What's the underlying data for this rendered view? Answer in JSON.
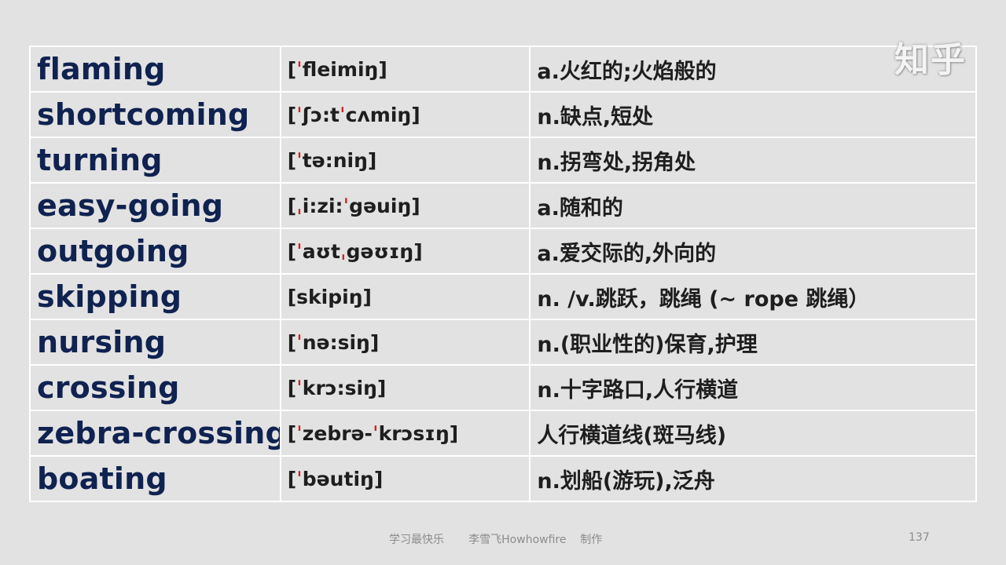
{
  "watermark": "知乎",
  "rows": [
    {
      "word": "flaming",
      "phonetic": "[ˈfleimiŋ]",
      "meaning": "a.火红的;火焰般的"
    },
    {
      "word": "shortcoming",
      "phonetic": "[ˈʃɔ:tˈcʌmiŋ]",
      "meaning": "n.缺点,短处"
    },
    {
      "word": "turning",
      "phonetic": "[ˈtə:niŋ]",
      "meaning": "n.拐弯处,拐角处"
    },
    {
      "word": "easy-going",
      "phonetic": "[ˌi:zi:ˈgəuiŋ]",
      "meaning": "a.随和的"
    },
    {
      "word": "outgoing",
      "phonetic": "[ˈaʊtˌgəʊɪŋ]",
      "meaning": "a.爱交际的,外向的"
    },
    {
      "word": "skipping",
      "phonetic": "[skipiŋ]",
      "meaning": "n. /v.跳跃，跳绳 (~ rope 跳绳）"
    },
    {
      "word": "nursing",
      "phonetic": "[ˈnə:siŋ]",
      "meaning": "n.(职业性的)保育,护理"
    },
    {
      "word": "crossing",
      "phonetic": "[ˈkrɔ:siŋ]",
      "meaning": "n.十字路口,人行横道"
    },
    {
      "word": "zebra-crossing",
      "phonetic": "[ˈzebrə-ˈkrɔsɪŋ]",
      "meaning": "人行横道线(斑马线)"
    },
    {
      "word": "boating",
      "phonetic": "[ˈbəutiŋ]",
      "meaning": "n.划船(游玩),泛舟"
    }
  ],
  "footer": {
    "credit": "学习最快乐       李雪飞Howhowfire    制作",
    "page_number": "137"
  }
}
